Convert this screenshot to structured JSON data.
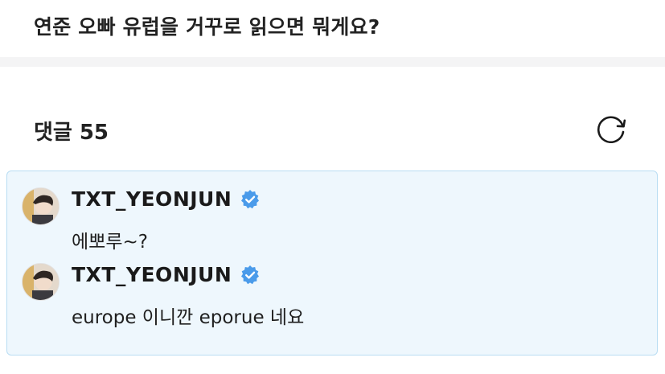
{
  "post": {
    "title": "연준 오빠 유럽을 거꾸로 읽으면 뭐게요?"
  },
  "comments_section": {
    "label": "댓글",
    "count": "55",
    "refresh_icon": "refresh-icon"
  },
  "comments": [
    {
      "author": "TXT_YEONJUN",
      "verified": true,
      "text": "에뽀루~?"
    },
    {
      "author": "TXT_YEONJUN",
      "verified": true,
      "text": "europe 이니깐 eporue 네요"
    }
  ],
  "colors": {
    "card_bg": "#eef7fd",
    "card_border": "#b9ddf3",
    "verified_blue": "#4a9bea",
    "divider": "#f4f4f5"
  }
}
